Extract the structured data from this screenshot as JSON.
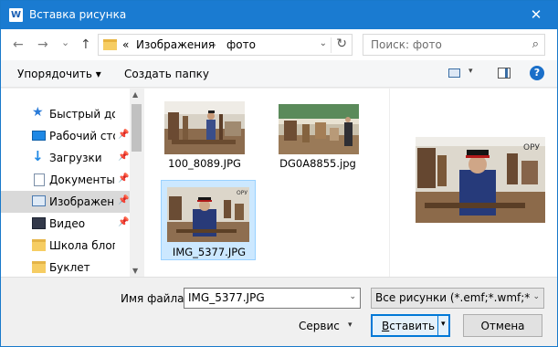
{
  "window": {
    "title": "Вставка рисунка",
    "app_icon": "W",
    "close_glyph": "✕"
  },
  "nav": {
    "back_glyph": "←",
    "forward_glyph": "→",
    "history_glyph": "⌄",
    "up_glyph": "↑",
    "address": {
      "overflow": "«",
      "segments": [
        "Изображения",
        "фото"
      ],
      "separator": "›",
      "dropdown_glyph": "⌄",
      "refresh_glyph": "↻"
    },
    "search_placeholder": "Поиск: фото",
    "search_glyph": "⌕"
  },
  "toolbar": {
    "organize_label": "Упорядочить ▾",
    "new_folder_label": "Создать папку",
    "view_dropdown_glyph": "▾",
    "help_glyph": "?"
  },
  "sidebar": {
    "items": [
      {
        "label": "Быстрый доступ",
        "icon": "star-icon",
        "pinned": false
      },
      {
        "label": "Рабочий стол",
        "icon": "desktop-icon",
        "pinned": true
      },
      {
        "label": "Загрузки",
        "icon": "download-icon",
        "pinned": true
      },
      {
        "label": "Документы",
        "icon": "documents-icon",
        "pinned": true
      },
      {
        "label": "Изображения",
        "icon": "pictures-icon",
        "pinned": true,
        "selected": true
      },
      {
        "label": "Видео",
        "icon": "video-icon",
        "pinned": true
      },
      {
        "label": "Школа блоггера",
        "icon": "folder-icon",
        "pinned": false
      },
      {
        "label": "Буклет",
        "icon": "folder-icon",
        "pinned": false
      }
    ],
    "pin_glyph": "📌",
    "expand_glyph": "›"
  },
  "files": [
    {
      "name": "100_8089.JPG",
      "selected": false
    },
    {
      "name": "DG0A8855.jpg",
      "selected": false
    },
    {
      "name": "IMG_5377.JPG",
      "selected": true
    }
  ],
  "preview": {
    "overlay_text": "ОРУ"
  },
  "bottom": {
    "filename_label": "Имя файла:",
    "filename_value": "IMG_5377.JPG",
    "filetype_value": "Все рисунки (*.emf;*.wmf;*.jpg",
    "tools_label": "Сервис",
    "insert_label_underlined": "В",
    "insert_label_rest": "ставить",
    "cancel_label": "Отмена",
    "dropdown_glyph": "▾"
  },
  "colors": {
    "titlebar": "#1a7bd1",
    "selection": "#cce8ff",
    "sidebar_selected": "#d9d9d9",
    "accent": "#0078d7"
  }
}
